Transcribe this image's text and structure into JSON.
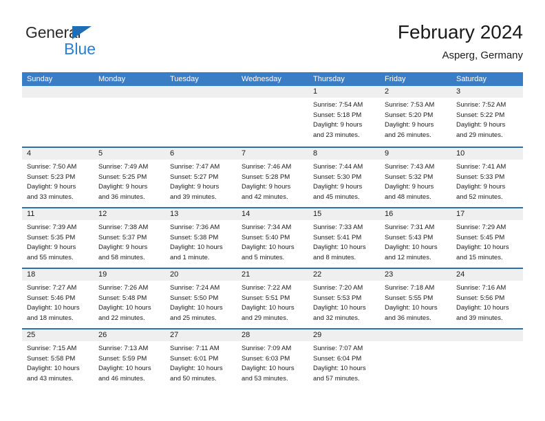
{
  "brand": {
    "name_part1": "General",
    "name_part2": "Blue",
    "triangle_color": "#1f6db5",
    "blue_color": "#2a7fd4"
  },
  "header": {
    "title": "February 2024",
    "subtitle": "Asperg, Germany"
  },
  "theme": {
    "header_blue": "#3b7dc4",
    "week_divider_blue": "#2e6da8",
    "day_band_gray": "#efefef"
  },
  "weekdays": [
    "Sunday",
    "Monday",
    "Tuesday",
    "Wednesday",
    "Thursday",
    "Friday",
    "Saturday"
  ],
  "weeks": [
    [
      {
        "day": "",
        "lines": []
      },
      {
        "day": "",
        "lines": []
      },
      {
        "day": "",
        "lines": []
      },
      {
        "day": "",
        "lines": []
      },
      {
        "day": "1",
        "lines": [
          "Sunrise: 7:54 AM",
          "Sunset: 5:18 PM",
          "Daylight: 9 hours",
          "and 23 minutes."
        ]
      },
      {
        "day": "2",
        "lines": [
          "Sunrise: 7:53 AM",
          "Sunset: 5:20 PM",
          "Daylight: 9 hours",
          "and 26 minutes."
        ]
      },
      {
        "day": "3",
        "lines": [
          "Sunrise: 7:52 AM",
          "Sunset: 5:22 PM",
          "Daylight: 9 hours",
          "and 29 minutes."
        ]
      }
    ],
    [
      {
        "day": "4",
        "lines": [
          "Sunrise: 7:50 AM",
          "Sunset: 5:23 PM",
          "Daylight: 9 hours",
          "and 33 minutes."
        ]
      },
      {
        "day": "5",
        "lines": [
          "Sunrise: 7:49 AM",
          "Sunset: 5:25 PM",
          "Daylight: 9 hours",
          "and 36 minutes."
        ]
      },
      {
        "day": "6",
        "lines": [
          "Sunrise: 7:47 AM",
          "Sunset: 5:27 PM",
          "Daylight: 9 hours",
          "and 39 minutes."
        ]
      },
      {
        "day": "7",
        "lines": [
          "Sunrise: 7:46 AM",
          "Sunset: 5:28 PM",
          "Daylight: 9 hours",
          "and 42 minutes."
        ]
      },
      {
        "day": "8",
        "lines": [
          "Sunrise: 7:44 AM",
          "Sunset: 5:30 PM",
          "Daylight: 9 hours",
          "and 45 minutes."
        ]
      },
      {
        "day": "9",
        "lines": [
          "Sunrise: 7:43 AM",
          "Sunset: 5:32 PM",
          "Daylight: 9 hours",
          "and 48 minutes."
        ]
      },
      {
        "day": "10",
        "lines": [
          "Sunrise: 7:41 AM",
          "Sunset: 5:33 PM",
          "Daylight: 9 hours",
          "and 52 minutes."
        ]
      }
    ],
    [
      {
        "day": "11",
        "lines": [
          "Sunrise: 7:39 AM",
          "Sunset: 5:35 PM",
          "Daylight: 9 hours",
          "and 55 minutes."
        ]
      },
      {
        "day": "12",
        "lines": [
          "Sunrise: 7:38 AM",
          "Sunset: 5:37 PM",
          "Daylight: 9 hours",
          "and 58 minutes."
        ]
      },
      {
        "day": "13",
        "lines": [
          "Sunrise: 7:36 AM",
          "Sunset: 5:38 PM",
          "Daylight: 10 hours",
          "and 1 minute."
        ]
      },
      {
        "day": "14",
        "lines": [
          "Sunrise: 7:34 AM",
          "Sunset: 5:40 PM",
          "Daylight: 10 hours",
          "and 5 minutes."
        ]
      },
      {
        "day": "15",
        "lines": [
          "Sunrise: 7:33 AM",
          "Sunset: 5:41 PM",
          "Daylight: 10 hours",
          "and 8 minutes."
        ]
      },
      {
        "day": "16",
        "lines": [
          "Sunrise: 7:31 AM",
          "Sunset: 5:43 PM",
          "Daylight: 10 hours",
          "and 12 minutes."
        ]
      },
      {
        "day": "17",
        "lines": [
          "Sunrise: 7:29 AM",
          "Sunset: 5:45 PM",
          "Daylight: 10 hours",
          "and 15 minutes."
        ]
      }
    ],
    [
      {
        "day": "18",
        "lines": [
          "Sunrise: 7:27 AM",
          "Sunset: 5:46 PM",
          "Daylight: 10 hours",
          "and 18 minutes."
        ]
      },
      {
        "day": "19",
        "lines": [
          "Sunrise: 7:26 AM",
          "Sunset: 5:48 PM",
          "Daylight: 10 hours",
          "and 22 minutes."
        ]
      },
      {
        "day": "20",
        "lines": [
          "Sunrise: 7:24 AM",
          "Sunset: 5:50 PM",
          "Daylight: 10 hours",
          "and 25 minutes."
        ]
      },
      {
        "day": "21",
        "lines": [
          "Sunrise: 7:22 AM",
          "Sunset: 5:51 PM",
          "Daylight: 10 hours",
          "and 29 minutes."
        ]
      },
      {
        "day": "22",
        "lines": [
          "Sunrise: 7:20 AM",
          "Sunset: 5:53 PM",
          "Daylight: 10 hours",
          "and 32 minutes."
        ]
      },
      {
        "day": "23",
        "lines": [
          "Sunrise: 7:18 AM",
          "Sunset: 5:55 PM",
          "Daylight: 10 hours",
          "and 36 minutes."
        ]
      },
      {
        "day": "24",
        "lines": [
          "Sunrise: 7:16 AM",
          "Sunset: 5:56 PM",
          "Daylight: 10 hours",
          "and 39 minutes."
        ]
      }
    ],
    [
      {
        "day": "25",
        "lines": [
          "Sunrise: 7:15 AM",
          "Sunset: 5:58 PM",
          "Daylight: 10 hours",
          "and 43 minutes."
        ]
      },
      {
        "day": "26",
        "lines": [
          "Sunrise: 7:13 AM",
          "Sunset: 5:59 PM",
          "Daylight: 10 hours",
          "and 46 minutes."
        ]
      },
      {
        "day": "27",
        "lines": [
          "Sunrise: 7:11 AM",
          "Sunset: 6:01 PM",
          "Daylight: 10 hours",
          "and 50 minutes."
        ]
      },
      {
        "day": "28",
        "lines": [
          "Sunrise: 7:09 AM",
          "Sunset: 6:03 PM",
          "Daylight: 10 hours",
          "and 53 minutes."
        ]
      },
      {
        "day": "29",
        "lines": [
          "Sunrise: 7:07 AM",
          "Sunset: 6:04 PM",
          "Daylight: 10 hours",
          "and 57 minutes."
        ]
      },
      {
        "day": "",
        "lines": []
      },
      {
        "day": "",
        "lines": []
      }
    ]
  ]
}
